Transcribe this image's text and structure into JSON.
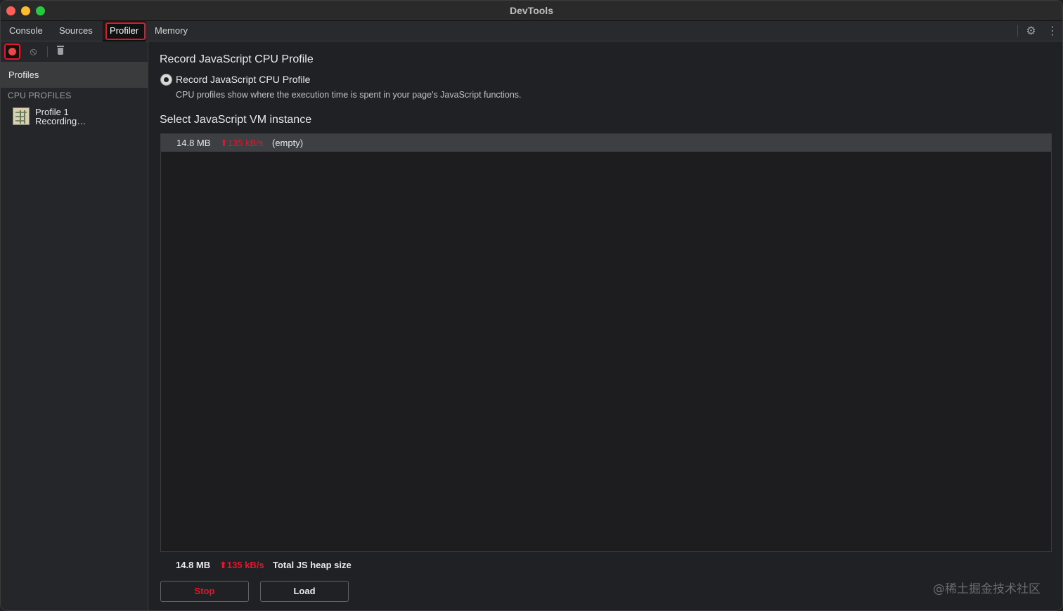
{
  "window": {
    "title": "DevTools"
  },
  "tabs": [
    {
      "label": "Console"
    },
    {
      "label": "Sources"
    },
    {
      "label": "Profiler",
      "active": true
    },
    {
      "label": "Memory"
    }
  ],
  "toolbar": {
    "settings_icon": "gear-icon",
    "more_icon": "kebab-icon",
    "record_icon": "record-icon",
    "clear_icon": "clear-icon",
    "delete_icon": "trash-icon"
  },
  "sidebar": {
    "header": "Profiles",
    "section_label": "CPU PROFILES",
    "profiles": [
      {
        "title": "Profile 1",
        "status": "Recording…"
      }
    ]
  },
  "main": {
    "title": "Record JavaScript CPU Profile",
    "radio_label": "Record JavaScript CPU Profile",
    "radio_description": "CPU profiles show where the execution time is spent in your page's JavaScript functions.",
    "vm_section_title": "Select JavaScript VM instance",
    "vm_instances": [
      {
        "size": "14.8 MB",
        "rate": "⬆135 kB/s",
        "name": "(empty)"
      }
    ],
    "heap": {
      "size": "14.8 MB",
      "rate": "⬆135 kB/s",
      "label": "Total JS heap size"
    },
    "stop_label": "Stop",
    "load_label": "Load"
  },
  "colors": {
    "accent_red": "#e8142a",
    "background": "#202124",
    "sidebar": "#252629"
  },
  "watermark": "@稀土掘金技术社区"
}
